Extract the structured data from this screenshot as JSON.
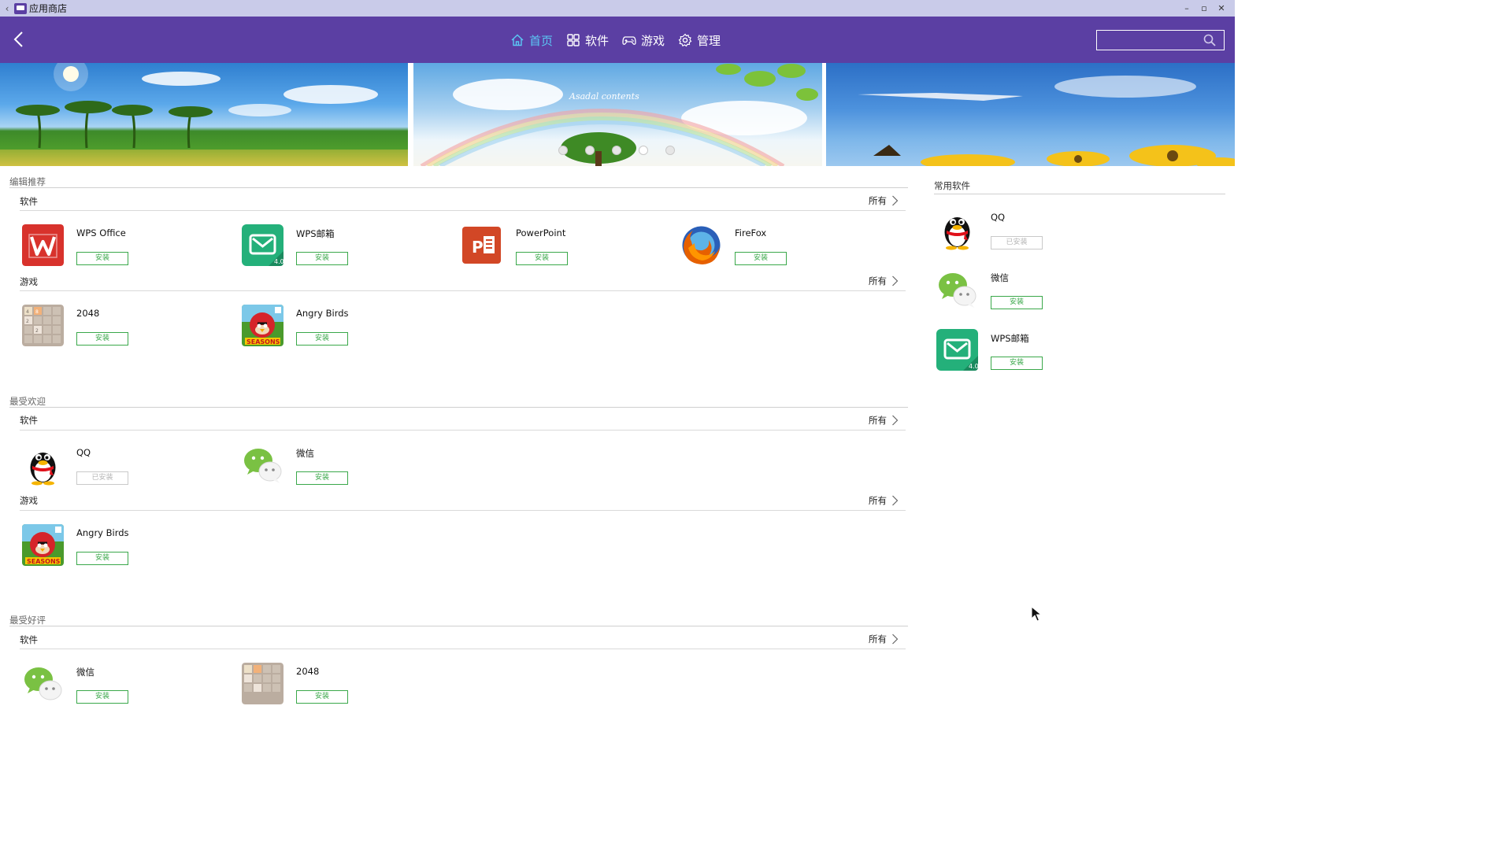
{
  "window": {
    "title": "应用商店",
    "controls": [
      "–",
      "▫",
      "✕"
    ]
  },
  "nav": {
    "tabs": [
      {
        "label": "首页",
        "icon": "home-icon"
      },
      {
        "label": "软件",
        "icon": "grid-icon"
      },
      {
        "label": "游戏",
        "icon": "gamepad-icon"
      },
      {
        "label": "管理",
        "icon": "gear-icon"
      }
    ],
    "search": {
      "value": "",
      "placeholder": ""
    }
  },
  "banner": {
    "overlay_text": "Asadal contents",
    "dot_count": 5,
    "active_dot": 4
  },
  "sections": [
    {
      "title": "编辑推荐",
      "groups": [
        {
          "title": "软件",
          "all_label": "所有",
          "apps": [
            {
              "name": "WPS Office",
              "button": "安装",
              "icon": "wps-office-icon"
            },
            {
              "name": "WPS邮箱",
              "button": "安装",
              "icon": "wps-mail-icon"
            },
            {
              "name": "PowerPoint",
              "button": "安装",
              "icon": "powerpoint-icon"
            },
            {
              "name": "FireFox",
              "button": "安装",
              "icon": "firefox-icon"
            }
          ]
        },
        {
          "title": "游戏",
          "all_label": "所有",
          "apps": [
            {
              "name": "2048",
              "button": "安装",
              "icon": "game-2048-icon"
            },
            {
              "name": "Angry Birds",
              "button": "安装",
              "icon": "angry-birds-icon"
            }
          ]
        }
      ]
    },
    {
      "title": "最受欢迎",
      "groups": [
        {
          "title": "软件",
          "all_label": "所有",
          "apps": [
            {
              "name": "QQ",
              "button": "已安装",
              "icon": "qq-icon"
            },
            {
              "name": "微信",
              "button": "安装",
              "icon": "wechat-icon"
            }
          ]
        },
        {
          "title": "游戏",
          "all_label": "所有",
          "apps": [
            {
              "name": "Angry Birds",
              "button": "安装",
              "icon": "angry-birds-icon"
            }
          ]
        }
      ]
    },
    {
      "title": "最受好评",
      "groups": [
        {
          "title": "软件",
          "all_label": "所有",
          "apps": [
            {
              "name": "微信",
              "button": "安装",
              "icon": "wechat-icon"
            },
            {
              "name": "2048",
              "button": "安装",
              "icon": "game-2048-icon"
            }
          ]
        }
      ]
    }
  ],
  "sidebar": {
    "title": "常用软件",
    "apps": [
      {
        "name": "QQ",
        "button": "已安装",
        "icon": "qq-icon"
      },
      {
        "name": "微信",
        "button": "安装",
        "icon": "wechat-icon"
      },
      {
        "name": "WPS邮箱",
        "button": "安装",
        "icon": "wps-mail-icon"
      }
    ]
  },
  "colors": {
    "nav_bg": "#5b3fa3",
    "active_tab": "#5bc8f5",
    "install_green": "#3aa84a",
    "titlebar_bg": "#c9cbe9"
  }
}
